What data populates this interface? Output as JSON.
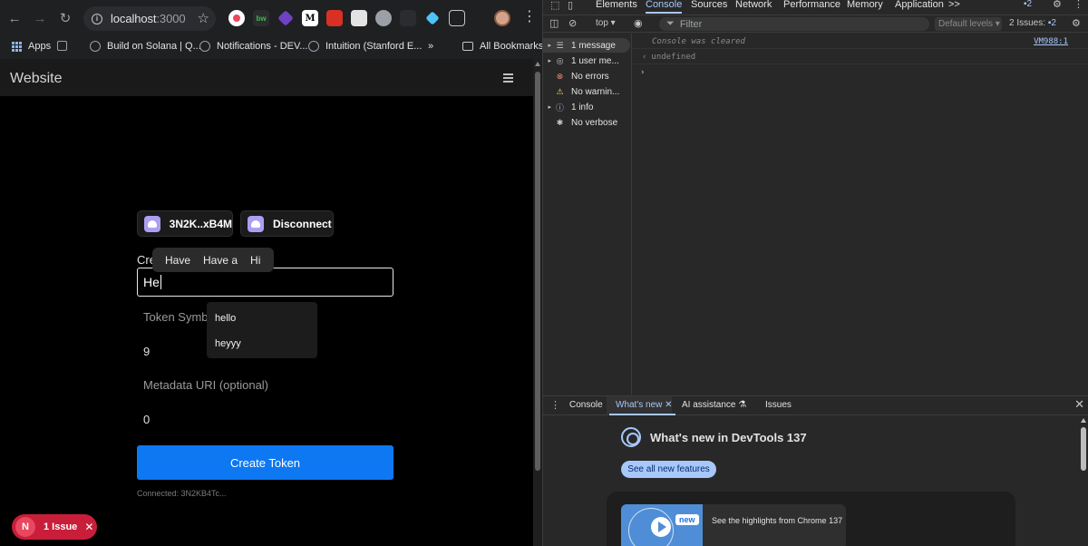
{
  "browser": {
    "nav": {
      "back_icon": "←",
      "forward_icon": "→",
      "reload_icon": "↻"
    },
    "omnibox": {
      "host": "localhost",
      "port": ":3000"
    },
    "bookmarks": [
      {
        "label": "Apps"
      },
      {
        "label": "Build on Solana | Q..."
      },
      {
        "label": "Notifications - DEV..."
      },
      {
        "label": "Intuition (Stanford E..."
      },
      {
        "label": "»"
      },
      {
        "label": "All Bookmarks"
      }
    ]
  },
  "page": {
    "site_title": "Website",
    "wallet_button": "3N2K..xB4M",
    "disconnect_button": "Disconnect",
    "name_label": "Cre",
    "name_value": "He",
    "symbol_label": "Token Symbo",
    "decimals_value": "9",
    "metadata_label": "Metadata URI (optional)",
    "supply_value": "0",
    "create_button": "Create Token",
    "connected_text": "Connected: 3N2KB4Tc...",
    "suggestions": [
      "Have",
      "Have a",
      "Hi"
    ],
    "autocomplete": [
      "hello",
      "heyyy"
    ],
    "issue_pill": {
      "logo": "N",
      "label": "1 Issue",
      "close": "✕"
    }
  },
  "devtools": {
    "tabs": [
      "Elements",
      "Console",
      "Sources",
      "Network",
      "Performance",
      "Memory",
      "Application",
      ">>"
    ],
    "active_tab": "Console",
    "issues_count_top": "2",
    "context": "top ▾",
    "filter_placeholder": "Filter",
    "levels": "Default levels ▾",
    "issues_label": "2 Issues:",
    "issues_count": "2",
    "sidebar": [
      {
        "label": "1 message",
        "icon": "list-icon",
        "expandable": true
      },
      {
        "label": "1 user me...",
        "icon": "user-icon",
        "expandable": true
      },
      {
        "label": "No errors",
        "icon": "error-icon",
        "expandable": false
      },
      {
        "label": "No warnin...",
        "icon": "warning-icon",
        "expandable": false
      },
      {
        "label": "1 info",
        "icon": "info-icon",
        "expandable": true
      },
      {
        "label": "No verbose",
        "icon": "verbose-icon",
        "expandable": false
      }
    ],
    "console": {
      "cleared": "Console was cleared",
      "source": "VM988:1",
      "undefined": "undefined",
      "prompt": "›"
    },
    "drawer": {
      "tabs": [
        "Console",
        "What's new",
        "AI assistance",
        "Issues"
      ],
      "active": "What's new",
      "whats_new_title": "What's new in DevTools 137",
      "see_all": "See all new features",
      "new_badge": "new",
      "highlights": "See the highlights from Chrome 137"
    }
  },
  "colors": {
    "accent_blue": "#0d78f2",
    "devtools_accent": "#a8c7fa",
    "issue_red": "#c81e3a",
    "phantom_purple": "#ab9ff2"
  }
}
